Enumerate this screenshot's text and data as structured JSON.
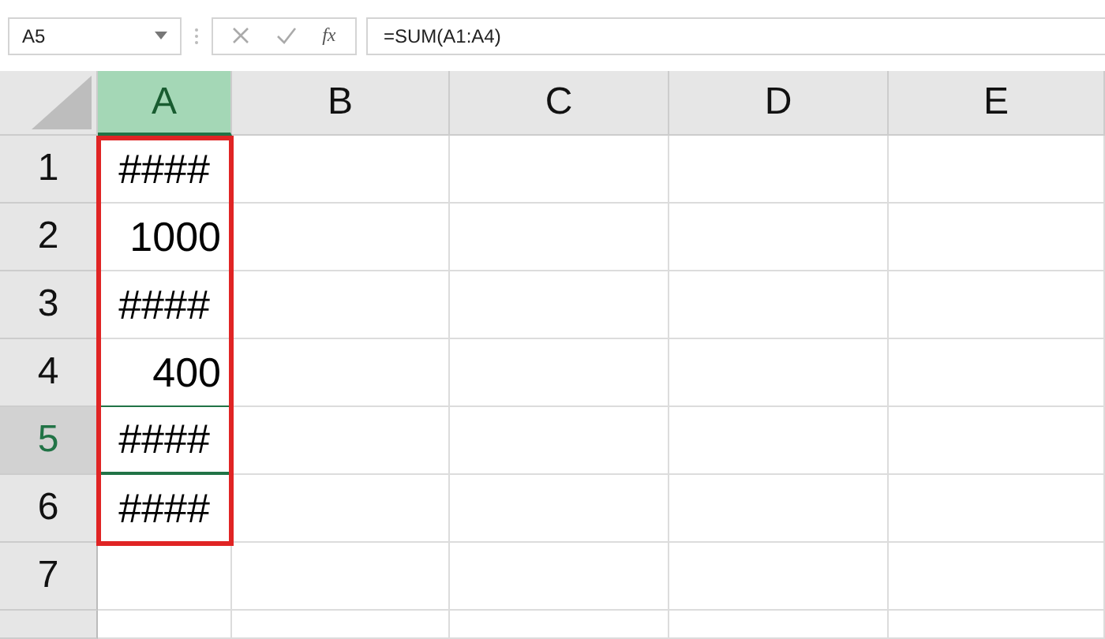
{
  "name_box": {
    "value": "A5"
  },
  "function_label": "fx",
  "formula": {
    "value": "=SUM(A1:A4)"
  },
  "columns": [
    {
      "label": "A",
      "selected": true
    },
    {
      "label": "B",
      "selected": false
    },
    {
      "label": "C",
      "selected": false
    },
    {
      "label": "D",
      "selected": false
    },
    {
      "label": "E",
      "selected": false
    }
  ],
  "rows": [
    {
      "label": "1",
      "selected": false,
      "cells": [
        {
          "value": "####",
          "kind": "overflow",
          "active": false
        }
      ]
    },
    {
      "label": "2",
      "selected": false,
      "cells": [
        {
          "value": "1000",
          "kind": "number",
          "active": false
        }
      ]
    },
    {
      "label": "3",
      "selected": false,
      "cells": [
        {
          "value": "####",
          "kind": "overflow",
          "active": false
        }
      ]
    },
    {
      "label": "4",
      "selected": false,
      "cells": [
        {
          "value": "400",
          "kind": "number",
          "active": false
        }
      ]
    },
    {
      "label": "5",
      "selected": true,
      "cells": [
        {
          "value": "####",
          "kind": "overflow",
          "active": true
        }
      ]
    },
    {
      "label": "6",
      "selected": false,
      "cells": [
        {
          "value": "####",
          "kind": "overflow",
          "active": false
        }
      ]
    },
    {
      "label": "7",
      "selected": false,
      "cells": []
    }
  ]
}
